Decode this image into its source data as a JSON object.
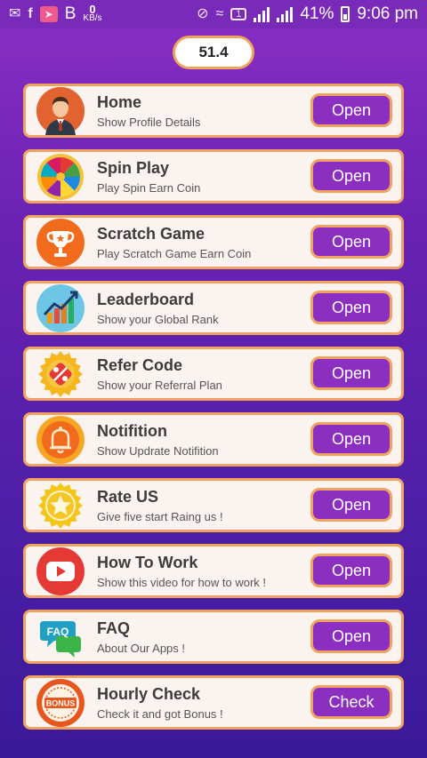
{
  "statusbar": {
    "speed_value": "0",
    "speed_unit": "KB/s",
    "b_label": "B",
    "sim_label": "1",
    "battery_percent": "41%",
    "time": "9:06 pm"
  },
  "balance": "51.4",
  "items": [
    {
      "title": "Home",
      "subtitle": "Show Profile Details",
      "button": "Open",
      "icon": "profile-avatar-icon"
    },
    {
      "title": "Spin Play",
      "subtitle": "Play Spin Earn Coin",
      "button": "Open",
      "icon": "spin-wheel-icon"
    },
    {
      "title": "Scratch Game",
      "subtitle": "Play Scratch Game Earn Coin",
      "button": "Open",
      "icon": "trophy-icon"
    },
    {
      "title": "Leaderboard",
      "subtitle": "Show your Global Rank",
      "button": "Open",
      "icon": "bar-chart-icon"
    },
    {
      "title": "Refer Code",
      "subtitle": "Show your Referral Plan",
      "button": "Open",
      "icon": "percent-badge-icon"
    },
    {
      "title": "Notifition",
      "subtitle": "Show Updrate Notifition",
      "button": "Open",
      "icon": "bell-icon"
    },
    {
      "title": "Rate US",
      "subtitle": "Give five start Raing us !",
      "button": "Open",
      "icon": "star-badge-icon"
    },
    {
      "title": "How To Work",
      "subtitle": "Show this video for how to work !",
      "button": "Open",
      "icon": "youtube-play-icon"
    },
    {
      "title": "FAQ",
      "subtitle": "About Our Apps !",
      "button": "Open",
      "icon": "faq-chat-icon"
    },
    {
      "title": "Hourly Check",
      "subtitle": "Check it and got Bonus !",
      "button": "Check",
      "icon": "bonus-badge-icon"
    }
  ],
  "icon_text": {
    "faq": "FAQ",
    "bonus": "BONUS"
  },
  "colors": {
    "button_bg": "#8b2fc1",
    "card_border": "#f2a25f",
    "card_bg": "#fbf3ef"
  }
}
